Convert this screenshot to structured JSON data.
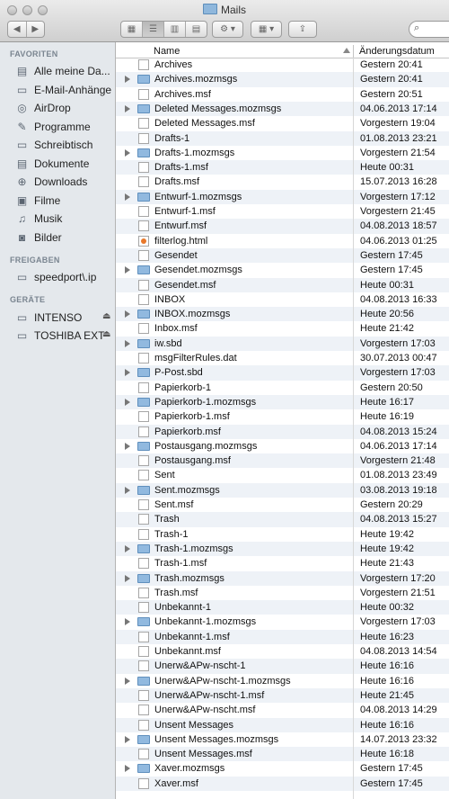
{
  "window": {
    "title": "Mails"
  },
  "toolbar": {
    "search_icon": "⌕"
  },
  "sidebar": {
    "favorites_header": "FAVORITEN",
    "favorites": [
      {
        "label": "Alle meine Da...",
        "icon": "files-icon"
      },
      {
        "label": "E-Mail-Anhänge",
        "icon": "folder-icon"
      },
      {
        "label": "AirDrop",
        "icon": "airdrop-icon"
      },
      {
        "label": "Programme",
        "icon": "apps-icon"
      },
      {
        "label": "Schreibtisch",
        "icon": "desktop-icon"
      },
      {
        "label": "Dokumente",
        "icon": "documents-icon"
      },
      {
        "label": "Downloads",
        "icon": "downloads-icon"
      },
      {
        "label": "Filme",
        "icon": "movies-icon"
      },
      {
        "label": "Musik",
        "icon": "music-icon"
      },
      {
        "label": "Bilder",
        "icon": "pictures-icon"
      }
    ],
    "shared_header": "FREIGABEN",
    "shared": [
      {
        "label": "speedport\\.ip",
        "icon": "server-icon"
      }
    ],
    "devices_header": "GERÄTE",
    "devices": [
      {
        "label": "INTENSO",
        "icon": "drive-icon"
      },
      {
        "label": "TOSHIBA EXT",
        "icon": "drive-icon"
      }
    ]
  },
  "columns": {
    "name": "Name",
    "date": "Änderungsdatum"
  },
  "rows": [
    {
      "name": "Archives",
      "date": "Gestern 20:41",
      "type": "file"
    },
    {
      "name": "Archives.mozmsgs",
      "date": "Gestern 20:41",
      "type": "folder"
    },
    {
      "name": "Archives.msf",
      "date": "Gestern 20:51",
      "type": "file"
    },
    {
      "name": "Deleted Messages.mozmsgs",
      "date": "04.06.2013 17:14",
      "type": "folder"
    },
    {
      "name": "Deleted Messages.msf",
      "date": "Vorgestern 19:04",
      "type": "file"
    },
    {
      "name": "Drafts-1",
      "date": "01.08.2013 23:21",
      "type": "file"
    },
    {
      "name": "Drafts-1.mozmsgs",
      "date": "Vorgestern 21:54",
      "type": "folder"
    },
    {
      "name": "Drafts-1.msf",
      "date": "Heute 00:31",
      "type": "file"
    },
    {
      "name": "Drafts.msf",
      "date": "15.07.2013 16:28",
      "type": "file"
    },
    {
      "name": "Entwurf-1.mozmsgs",
      "date": "Vorgestern 17:12",
      "type": "folder"
    },
    {
      "name": "Entwurf-1.msf",
      "date": "Vorgestern 21:45",
      "type": "file"
    },
    {
      "name": "Entwurf.msf",
      "date": "04.08.2013 18:57",
      "type": "file"
    },
    {
      "name": "filterlog.html",
      "date": "04.06.2013 01:25",
      "type": "html"
    },
    {
      "name": "Gesendet",
      "date": "Gestern 17:45",
      "type": "file"
    },
    {
      "name": "Gesendet.mozmsgs",
      "date": "Gestern 17:45",
      "type": "folder"
    },
    {
      "name": "Gesendet.msf",
      "date": "Heute 00:31",
      "type": "file"
    },
    {
      "name": "INBOX",
      "date": "04.08.2013 16:33",
      "type": "file"
    },
    {
      "name": "INBOX.mozmsgs",
      "date": "Heute 20:56",
      "type": "folder"
    },
    {
      "name": "Inbox.msf",
      "date": "Heute 21:42",
      "type": "file"
    },
    {
      "name": "iw.sbd",
      "date": "Vorgestern 17:03",
      "type": "folder"
    },
    {
      "name": "msgFilterRules.dat",
      "date": "30.07.2013 00:47",
      "type": "file"
    },
    {
      "name": "P-Post.sbd",
      "date": "Vorgestern 17:03",
      "type": "folder"
    },
    {
      "name": "Papierkorb-1",
      "date": "Gestern 20:50",
      "type": "file"
    },
    {
      "name": "Papierkorb-1.mozmsgs",
      "date": "Heute 16:17",
      "type": "folder"
    },
    {
      "name": "Papierkorb-1.msf",
      "date": "Heute 16:19",
      "type": "file"
    },
    {
      "name": "Papierkorb.msf",
      "date": "04.08.2013 15:24",
      "type": "file"
    },
    {
      "name": "Postausgang.mozmsgs",
      "date": "04.06.2013 17:14",
      "type": "folder"
    },
    {
      "name": "Postausgang.msf",
      "date": "Vorgestern 21:48",
      "type": "file"
    },
    {
      "name": "Sent",
      "date": "01.08.2013 23:49",
      "type": "file"
    },
    {
      "name": "Sent.mozmsgs",
      "date": "03.08.2013 19:18",
      "type": "folder"
    },
    {
      "name": "Sent.msf",
      "date": "Gestern 20:29",
      "type": "file"
    },
    {
      "name": "Trash",
      "date": "04.08.2013 15:27",
      "type": "file"
    },
    {
      "name": "Trash-1",
      "date": "Heute 19:42",
      "type": "file"
    },
    {
      "name": "Trash-1.mozmsgs",
      "date": "Heute 19:42",
      "type": "folder"
    },
    {
      "name": "Trash-1.msf",
      "date": "Heute 21:43",
      "type": "file"
    },
    {
      "name": "Trash.mozmsgs",
      "date": "Vorgestern 17:20",
      "type": "folder"
    },
    {
      "name": "Trash.msf",
      "date": "Vorgestern 21:51",
      "type": "file"
    },
    {
      "name": "Unbekannt-1",
      "date": "Heute 00:32",
      "type": "file"
    },
    {
      "name": "Unbekannt-1.mozmsgs",
      "date": "Vorgestern 17:03",
      "type": "folder"
    },
    {
      "name": "Unbekannt-1.msf",
      "date": "Heute 16:23",
      "type": "file"
    },
    {
      "name": "Unbekannt.msf",
      "date": "04.08.2013 14:54",
      "type": "file"
    },
    {
      "name": "Unerw&APw-nscht-1",
      "date": "Heute 16:16",
      "type": "file"
    },
    {
      "name": "Unerw&APw-nscht-1.mozmsgs",
      "date": "Heute 16:16",
      "type": "folder"
    },
    {
      "name": "Unerw&APw-nscht-1.msf",
      "date": "Heute 21:45",
      "type": "file"
    },
    {
      "name": "Unerw&APw-nscht.msf",
      "date": "04.08.2013 14:29",
      "type": "file"
    },
    {
      "name": "Unsent Messages",
      "date": "Heute 16:16",
      "type": "file"
    },
    {
      "name": "Unsent Messages.mozmsgs",
      "date": "14.07.2013 23:32",
      "type": "folder"
    },
    {
      "name": "Unsent Messages.msf",
      "date": "Heute 16:18",
      "type": "file"
    },
    {
      "name": "Xaver.mozmsgs",
      "date": "Gestern 17:45",
      "type": "folder"
    },
    {
      "name": "Xaver.msf",
      "date": "Gestern 17:45",
      "type": "file"
    }
  ]
}
